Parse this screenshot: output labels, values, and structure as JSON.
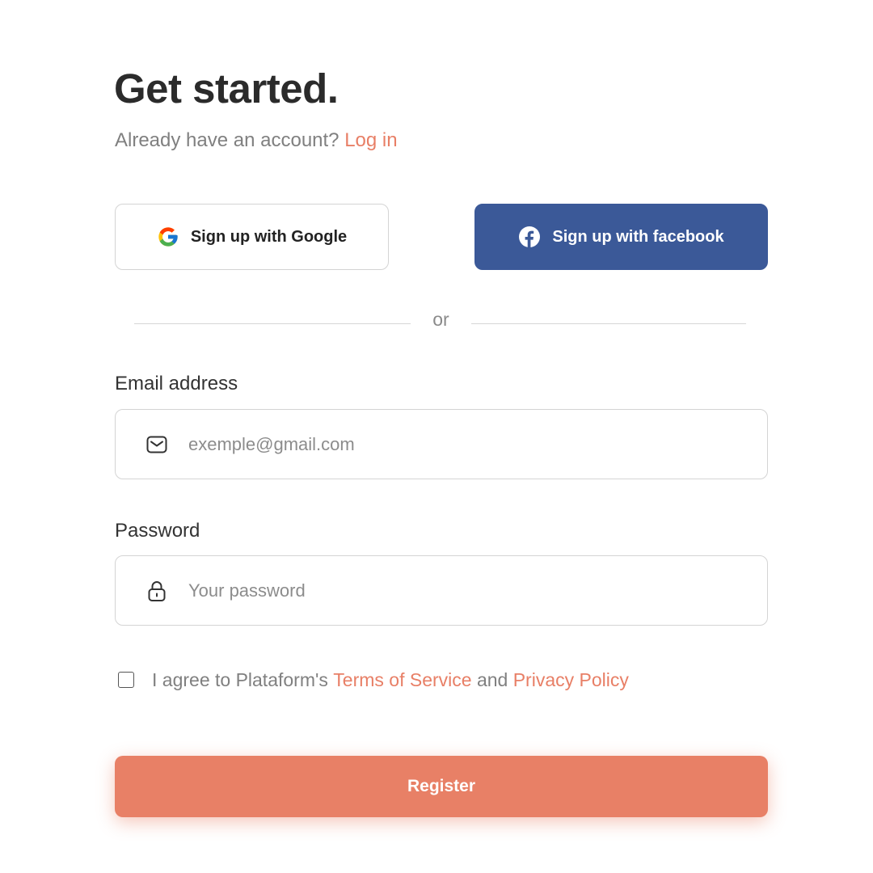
{
  "header": {
    "title": "Get started.",
    "subtitle": "Already have an account?",
    "login_link": "Log in"
  },
  "social": {
    "google_label": "Sign up with Google",
    "google_icon": "google-icon",
    "facebook_label": "Sign up with facebook",
    "facebook_icon": "facebook-icon",
    "facebook_color": "#3b5998"
  },
  "divider": {
    "text": "or"
  },
  "form": {
    "email": {
      "label": "Email address",
      "placeholder": "exemple@gmail.com",
      "value": "",
      "icon": "mail-icon"
    },
    "password": {
      "label": "Password",
      "placeholder": "Your password",
      "value": "",
      "icon": "lock-icon"
    },
    "agree": {
      "checked": false,
      "prefix": "I agree to Plataform's",
      "terms_link": "Terms of Service",
      "conjunction": "and",
      "privacy_link": "Privacy Policy"
    },
    "register_label": "Register"
  },
  "colors": {
    "accent": "#e88066",
    "title": "#2b2b2b",
    "muted": "#808080"
  }
}
